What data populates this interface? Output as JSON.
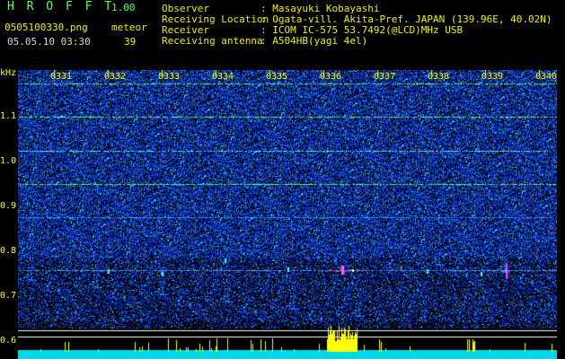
{
  "header": {
    "app_name": "H R O F F T",
    "version": "1.00",
    "filename": "0505100330.png",
    "datetime": "05.05.10 03:30",
    "meteor_label": "meteor",
    "meteor_count": "39",
    "fields": [
      {
        "label": "Observer",
        "value": ": Masayuki Kobayashi"
      },
      {
        "label": "Receiving Location",
        "value": ": Ogata-vill. Akita-Pref. JAPAN (139.96E, 40.02N)"
      },
      {
        "label": "Receiver",
        "value": ": ICOM IC-575 53.7492(@LCD)MHz USB"
      },
      {
        "label": "Receiving antenna",
        "value": ": A504HB(yagi 4el)"
      }
    ]
  },
  "spectrogram": {
    "y_unit": "kHz",
    "y_labels": [
      "1.1",
      "1.0",
      "0.9",
      "0.8",
      "0.7",
      "0.6"
    ],
    "x_labels": [
      "0331",
      "0332",
      "0333",
      "0334",
      "0335",
      "0336",
      "0337",
      "0338",
      "0339",
      "0340"
    ]
  },
  "colors": {
    "background": "#000000",
    "title_yellow": "#f0f000",
    "label_green": "#5cff5c",
    "noise_blue": "#1a3cff",
    "signal_cyan": "#30ffff",
    "level_cyan": "#00e0e0",
    "level_yellow": "#ffff00"
  }
}
